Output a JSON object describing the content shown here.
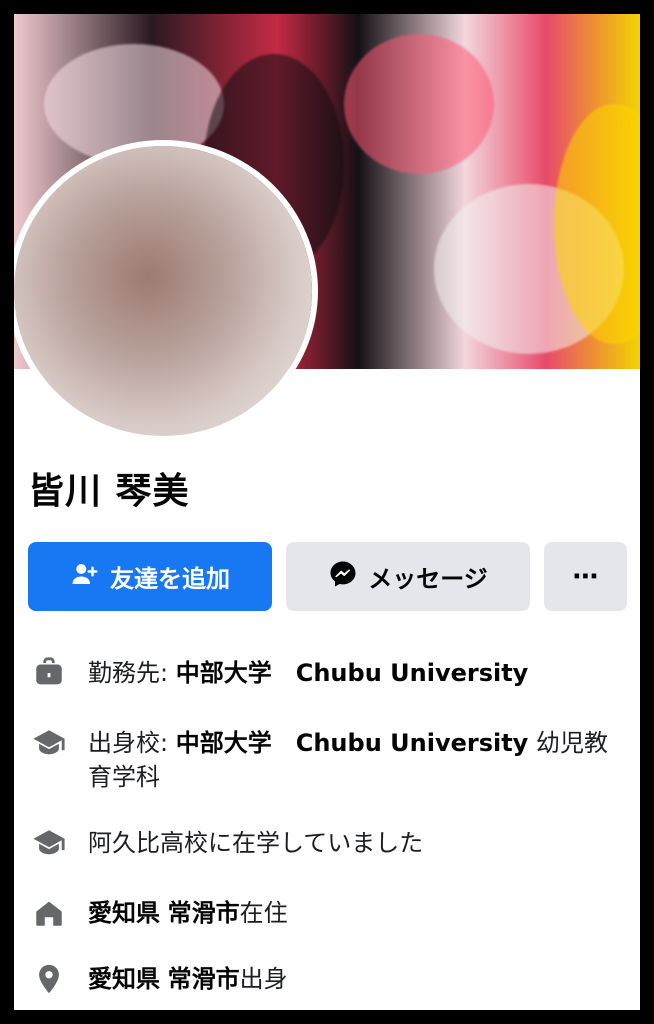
{
  "profile": {
    "name": "皆川 琴美"
  },
  "actions": {
    "add_friend_label": "友達を追加",
    "message_label": "メッセージ",
    "more_label": "⋯"
  },
  "about": {
    "work": {
      "prefix": "勤務先:",
      "value": "中部大学　Chubu University"
    },
    "education": {
      "prefix": "出身校:",
      "value": "中部大学　Chubu University",
      "suffix": "幼児教育学科"
    },
    "high_school": {
      "value": "阿久比高校に在学していました"
    },
    "lives_in": {
      "pref": "愛知県",
      "city": "常滑市",
      "suffix": "在住"
    },
    "from": {
      "pref": "愛知県",
      "city": "常滑市",
      "suffix": "出身"
    }
  },
  "colors": {
    "primary": "#1877f2",
    "secondary_bg": "#e4e6eb",
    "text": "#050505",
    "icon": "#65676b"
  },
  "icons": {
    "add_friend": "user-plus-icon",
    "messenger": "messenger-icon",
    "work": "briefcase-icon",
    "education": "graduation-cap-icon",
    "home": "home-icon",
    "location": "location-pin-icon"
  }
}
